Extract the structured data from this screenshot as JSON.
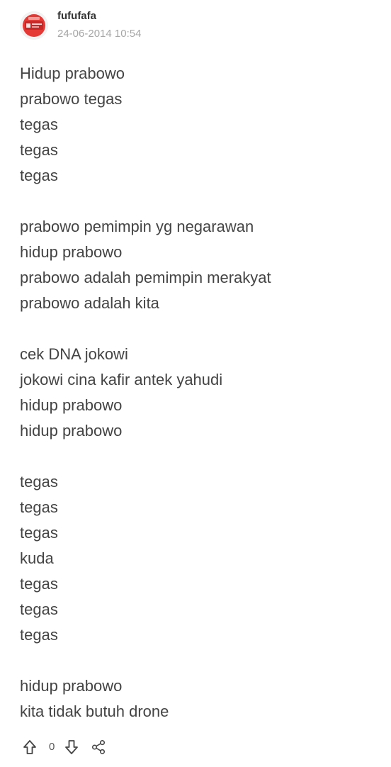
{
  "post": {
    "author": {
      "username": "fufufafa",
      "avatar_icon": "avatar-icon",
      "avatar_color": "#e53935"
    },
    "timestamp": "24-06-2014 10:54",
    "lines": [
      "Hidup prabowo",
      "prabowo tegas",
      "tegas",
      "tegas",
      "tegas",
      "",
      "prabowo pemimpin yg negarawan",
      "hidup prabowo",
      "prabowo adalah pemimpin merakyat",
      "prabowo adalah kita",
      "",
      "cek DNA jokowi",
      "jokowi cina kafir antek yahudi",
      "hidup prabowo",
      "hidup prabowo",
      "",
      "tegas",
      "tegas",
      "tegas",
      "kuda",
      "tegas",
      "tegas",
      "tegas",
      "",
      "hidup prabowo",
      "kita tidak butuh drone"
    ],
    "actions": {
      "upvote_icon": "arrow-up-icon",
      "vote_count": "0",
      "downvote_icon": "arrow-down-icon",
      "share_icon": "share-icon"
    }
  }
}
